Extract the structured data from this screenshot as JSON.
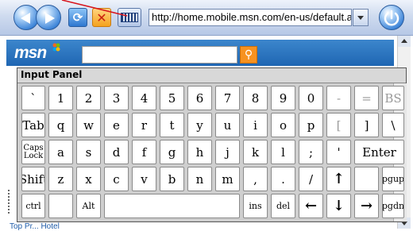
{
  "browser": {
    "address_url": "http://home.mobile.msn.com/en-us/default.aspx"
  },
  "page": {
    "logo_text": "msn",
    "search_placeholder": "",
    "bottom_link": "Top Pr... Hotel"
  },
  "input_panel": {
    "title": "Input Panel",
    "rows": [
      [
        "`",
        "1",
        "2",
        "3",
        "4",
        "5",
        "6",
        "7",
        "8",
        "9",
        "0",
        "-",
        "=",
        "BS"
      ],
      [
        "Tab",
        "q",
        "w",
        "e",
        "r",
        "t",
        "y",
        "u",
        "i",
        "o",
        "p",
        "[",
        "]",
        "\\"
      ],
      [
        "Caps\nLock",
        "a",
        "s",
        "d",
        "f",
        "g",
        "h",
        "j",
        "k",
        "l",
        ";",
        "'",
        "Enter"
      ],
      [
        "Shift",
        "z",
        "x",
        "c",
        "v",
        "b",
        "n",
        "m",
        ",",
        ".",
        "/",
        "↑",
        "",
        "pgup"
      ],
      [
        "ctrl",
        "",
        "Alt",
        "",
        "ins",
        "del",
        "←",
        "↓",
        "→",
        "pgdn"
      ]
    ]
  },
  "colors": {
    "msn_blue": "#2a73c0",
    "search_orange": "#f79220",
    "panel_gray": "#cfcfcf"
  }
}
